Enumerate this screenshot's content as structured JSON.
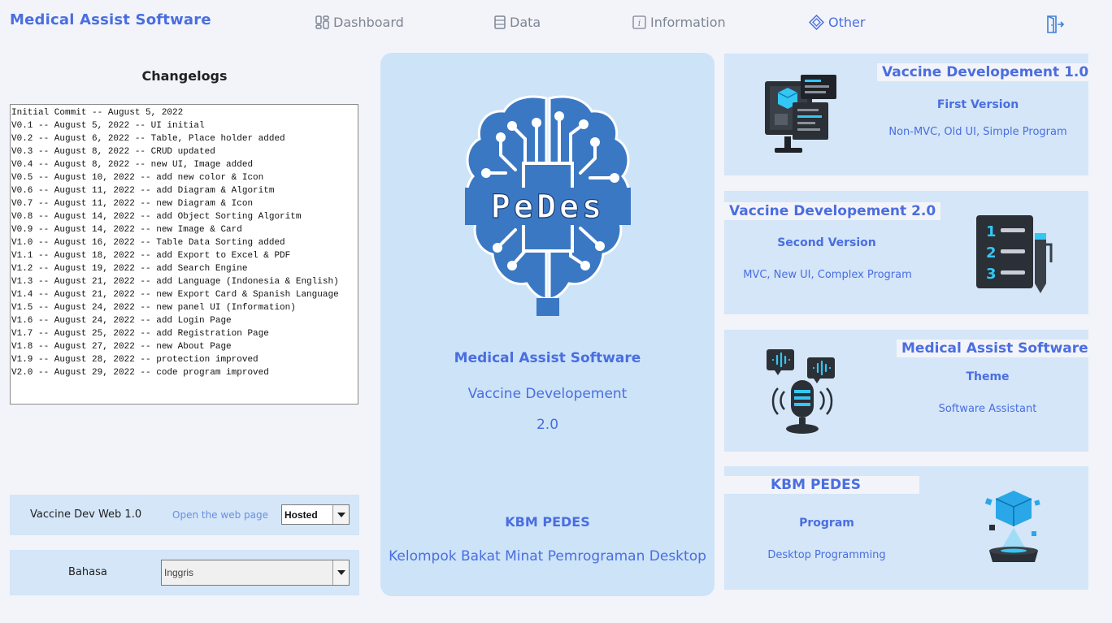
{
  "app": {
    "title": "Medical Assist Software"
  },
  "nav": {
    "dashboard": "Dashboard",
    "data": "Data",
    "information": "Information",
    "other": "Other"
  },
  "icons": {
    "dashboard": "dashboard-icon",
    "data": "data-icon",
    "information": "info-icon",
    "other": "diamond-icon",
    "logout": "logout-icon"
  },
  "changelog": {
    "title": "Changelogs",
    "lines": [
      "Initial Commit -- August 5, 2022",
      "V0.1 -- August 5, 2022 -- UI initial",
      "V0.2 -- August 6, 2022 -- Table, Place holder added",
      "V0.3 -- August 8, 2022 -- CRUD updated",
      "V0.4 -- August 8, 2022 -- new UI, Image added",
      "V0.5 -- August 10, 2022 -- add new color & Icon",
      "V0.6 -- August 11, 2022 -- add Diagram & Algoritm",
      "V0.7 -- August 11, 2022 -- new Diagram & Icon",
      "V0.8 -- August 14, 2022 -- add Object Sorting Algoritm",
      "V0.9 -- August 14, 2022 -- new Image & Card",
      "V1.0 -- August 16, 2022 -- Table Data Sorting added",
      "V1.1 -- August 18, 2022 -- add Export to Excel & PDF",
      "V1.2 -- August 19, 2022 -- add Search Engine",
      "V1.3 -- August 21, 2022 -- add Language (Indonesia & English)",
      "V1.4 -- August 21, 2022 -- new Export Card & Spanish Language",
      "V1.5 -- August 24, 2022 -- new panel UI (Information)",
      "V1.6 -- August 24, 2022 -- add Login Page",
      "V1.7 -- August 25, 2022 -- add Registration Page",
      "V1.8 -- August 27, 2022 -- new About Page",
      "V1.9 -- August 28, 2022 -- protection improved",
      "V2.0 -- August 29, 2022 -- code program improved"
    ]
  },
  "web": {
    "label": "Vaccine Dev Web 1.0",
    "link": "Open the web page",
    "mode": "Hosted"
  },
  "language": {
    "label": "Bahasa",
    "value": "Inggris"
  },
  "center": {
    "logo_text": "PeDes",
    "title": "Medical Assist Software",
    "subtitle": "Vaccine Developement",
    "version": "2.0",
    "org": "KBM PEDES",
    "org_full": "Kelompok Bakat Minat Pemrograman Desktop"
  },
  "cards": [
    {
      "tag": "Vaccine Developement 1.0",
      "line1": "First Version",
      "line2": "Non-MVC, Old UI, Simple Program",
      "icon": "monitor-icon"
    },
    {
      "tag": "Vaccine Developement 2.0",
      "line1": "Second Version",
      "line2": "MVC, New UI, Complex Program",
      "icon": "checklist-icon"
    },
    {
      "tag": "Medical Assist Software",
      "line1": "Theme",
      "line2": "Software Assistant",
      "icon": "microphone-icon"
    },
    {
      "tag": "KBM PEDES",
      "line1": "Program",
      "line2": "Desktop Programming",
      "icon": "hologram-cube-icon"
    }
  ],
  "colors": {
    "accent": "#4a6ee0",
    "panel": "#cde3f8",
    "card": "#d4e6f8",
    "background": "#f3f4f9",
    "brain": "#3b78c4"
  }
}
